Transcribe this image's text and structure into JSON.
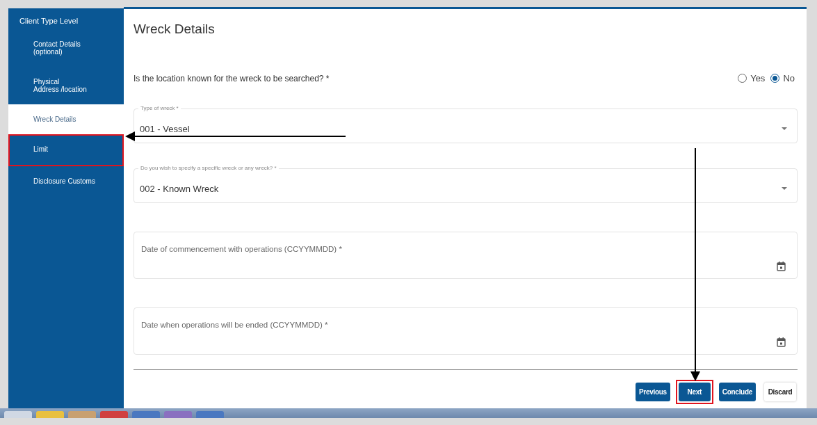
{
  "sidebar": {
    "heading": "Client Type Level",
    "items": [
      {
        "label": "Contact Details\n(optional)",
        "selected": false,
        "highlighted": false
      },
      {
        "label": "Physical\nAddress /location",
        "selected": false,
        "highlighted": false
      },
      {
        "label": "Wreck Details",
        "selected": true,
        "highlighted": false
      },
      {
        "label": "Limit",
        "selected": false,
        "highlighted": true
      },
      {
        "label": "Disclosure Customs",
        "selected": false,
        "highlighted": false
      }
    ]
  },
  "title": "Wreck Details",
  "question": {
    "text": "Is the location known for the wreck to be searched? *",
    "options": [
      {
        "label": "Yes",
        "selected": false
      },
      {
        "label": "No",
        "selected": true
      }
    ]
  },
  "fields": [
    {
      "kind": "select",
      "label": "Type of wreck *",
      "value": "001 - Vessel"
    },
    {
      "kind": "select",
      "label": "Do you wish to specify a specific wreck or any wreck? *",
      "value": "002 - Known Wreck"
    },
    {
      "kind": "date",
      "label": "Date of commencement with operations (CCYYMMDD) *"
    },
    {
      "kind": "date",
      "label": "Date when operations will be ended (CCYYMMDD) *"
    }
  ],
  "buttons": [
    {
      "label": "Previous",
      "kind": "primary",
      "highlighted": false
    },
    {
      "label": "Next",
      "kind": "primary",
      "highlighted": true
    },
    {
      "label": "Conclude",
      "kind": "primary",
      "highlighted": false
    },
    {
      "label": "Discard",
      "kind": "secondary",
      "highlighted": false
    }
  ]
}
